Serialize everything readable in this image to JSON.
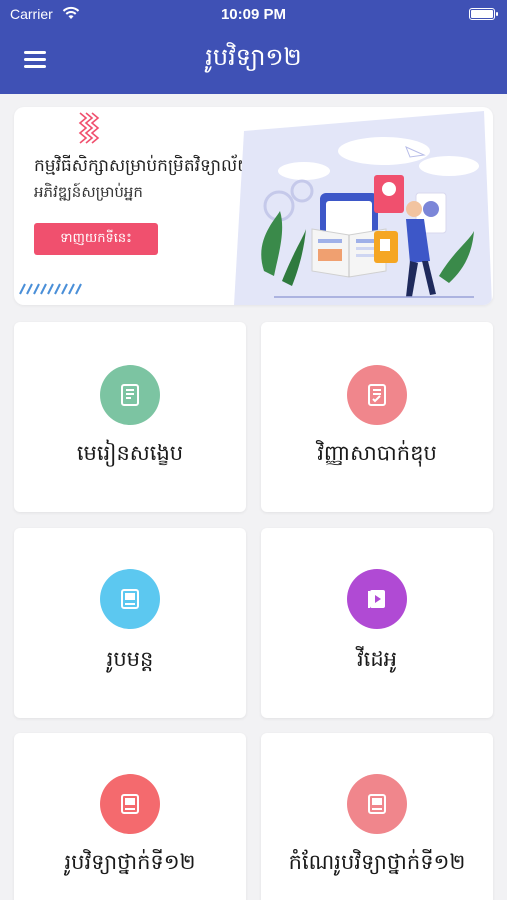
{
  "status_bar": {
    "carrier": "Carrier",
    "time": "10:09 PM"
  },
  "header": {
    "title": "រូបវិទ្យា១២",
    "menu_icon": "hamburger-menu-icon"
  },
  "banner": {
    "title": "កម្មវិធីសិក្សាសម្រាប់កម្រិតវិទ្យាល័យ",
    "subtitle": "អភិវឌ្ឍន៍សម្រាប់អ្នក",
    "button_label": "ទាញយកទីនេះ",
    "accent_color": "#f0506e"
  },
  "menu": {
    "items": [
      {
        "label": "មេរៀនសង្ខេប",
        "icon": "book-sheet-icon",
        "color": "#7cc4a2"
      },
      {
        "label": "វិញ្ញាសាបាក់ឌុប",
        "icon": "exam-sheet-icon",
        "color": "#f0868c"
      },
      {
        "label": "រូបមន្ត",
        "icon": "formula-book-icon",
        "color": "#5cc8f0"
      },
      {
        "label": "វីដេអូ",
        "icon": "video-book-icon",
        "color": "#b04ad4"
      },
      {
        "label": "រូបវិទ្យាថ្នាក់ទី១២",
        "icon": "textbook-icon",
        "color": "#f46a6e"
      },
      {
        "label": "កំណែរូបវិទ្យាថ្នាក់ទី១២",
        "icon": "solution-book-icon",
        "color": "#f0868c"
      }
    ]
  },
  "colors": {
    "header_bg": "#3f51b5",
    "page_bg": "#f2f2f4"
  }
}
